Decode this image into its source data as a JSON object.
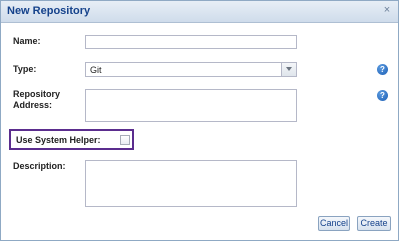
{
  "dialog": {
    "title": "New Repository",
    "close_symbol": "×"
  },
  "form": {
    "name_label": "Name:",
    "name_value": "",
    "type_label": "Type:",
    "type_value": "Git",
    "repository_address_label_line1": "Repository",
    "repository_address_label_line2": "Address:",
    "repository_address_value": "",
    "use_system_helper_label": "Use System Helper:",
    "use_system_helper_checked": false,
    "description_label": "Description:",
    "description_value": "",
    "help_symbol": "?"
  },
  "buttons": {
    "cancel_label": "Cancel",
    "create_label": "Create"
  },
  "colors": {
    "title_text": "#15428b",
    "highlight_border": "#5b2d8e",
    "help_icon": "#1d5fb5"
  }
}
